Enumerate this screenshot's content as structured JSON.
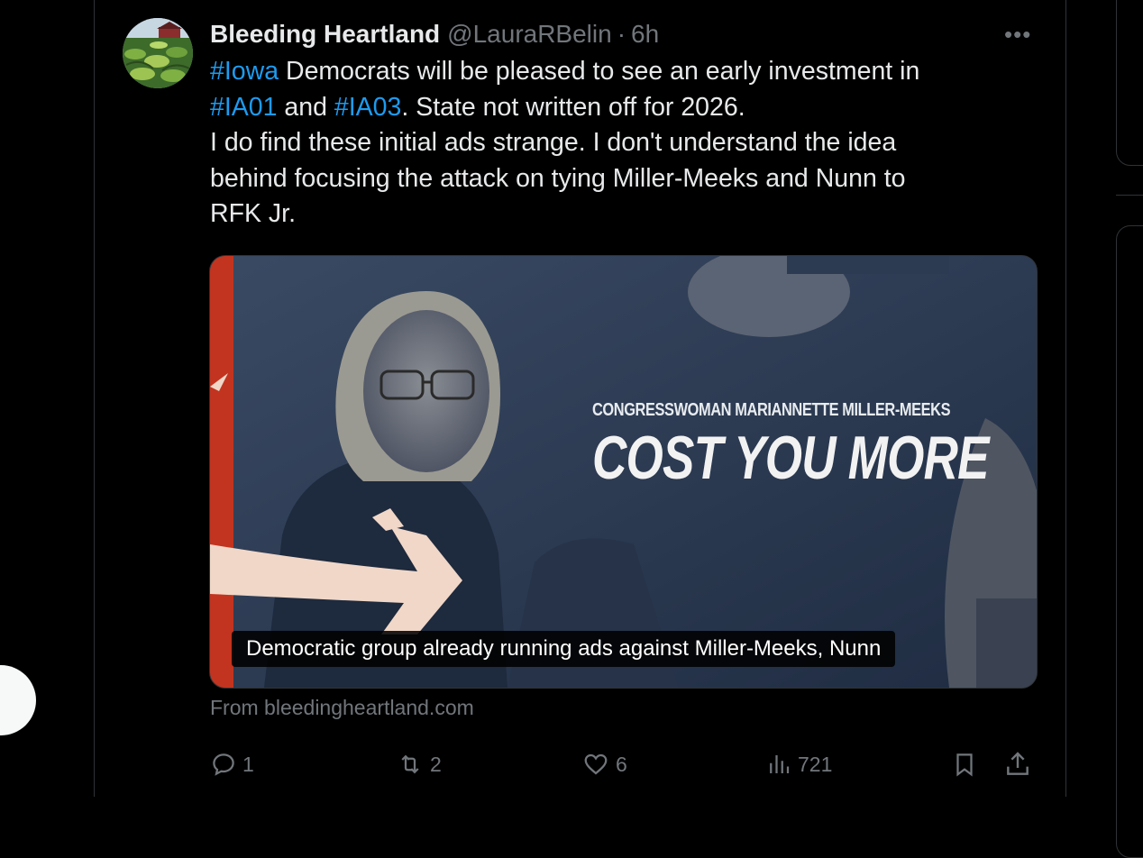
{
  "tweet": {
    "author": {
      "display_name": "Bleeding Heartland",
      "handle": "@LauraRBelin",
      "separator": "·",
      "time": "6h"
    },
    "more_label": "•••",
    "text": {
      "line1": {
        "hashtag1": "#Iowa",
        "rest": " Democrats will be pleased to see an early investment in"
      },
      "line2": {
        "hashtag1": "#IA01",
        "mid": " and ",
        "hashtag2": "#IA03",
        "rest": ". State not written off for 2026."
      },
      "line3": "I do find these initial ads strange. I don't understand the idea",
      "line4": "behind focusing the attack on tying Miller-Meeks and Nunn to",
      "line5": "RFK Jr."
    },
    "media": {
      "overlay_small": "CONGRESSWOMAN MARIANNETTE MILLER-MEEKS",
      "overlay_big": "COST YOU MORE",
      "caption": "Democratic group already running ads against Miller-Meeks, Nunn"
    },
    "link_source": "From bleedingheartland.com",
    "actions": {
      "replies": "1",
      "reposts": "2",
      "likes": "6",
      "views": "721"
    }
  },
  "icons": {
    "reply": "reply-icon",
    "repost": "repost-icon",
    "like": "heart-icon",
    "views": "bar-chart-icon",
    "bookmark": "bookmark-icon",
    "share": "share-icon",
    "more": "more-icon"
  },
  "colors": {
    "background": "#000000",
    "text": "#e7e9ea",
    "muted": "#71767b",
    "link": "#1d9bf0",
    "border": "#2f3336"
  }
}
